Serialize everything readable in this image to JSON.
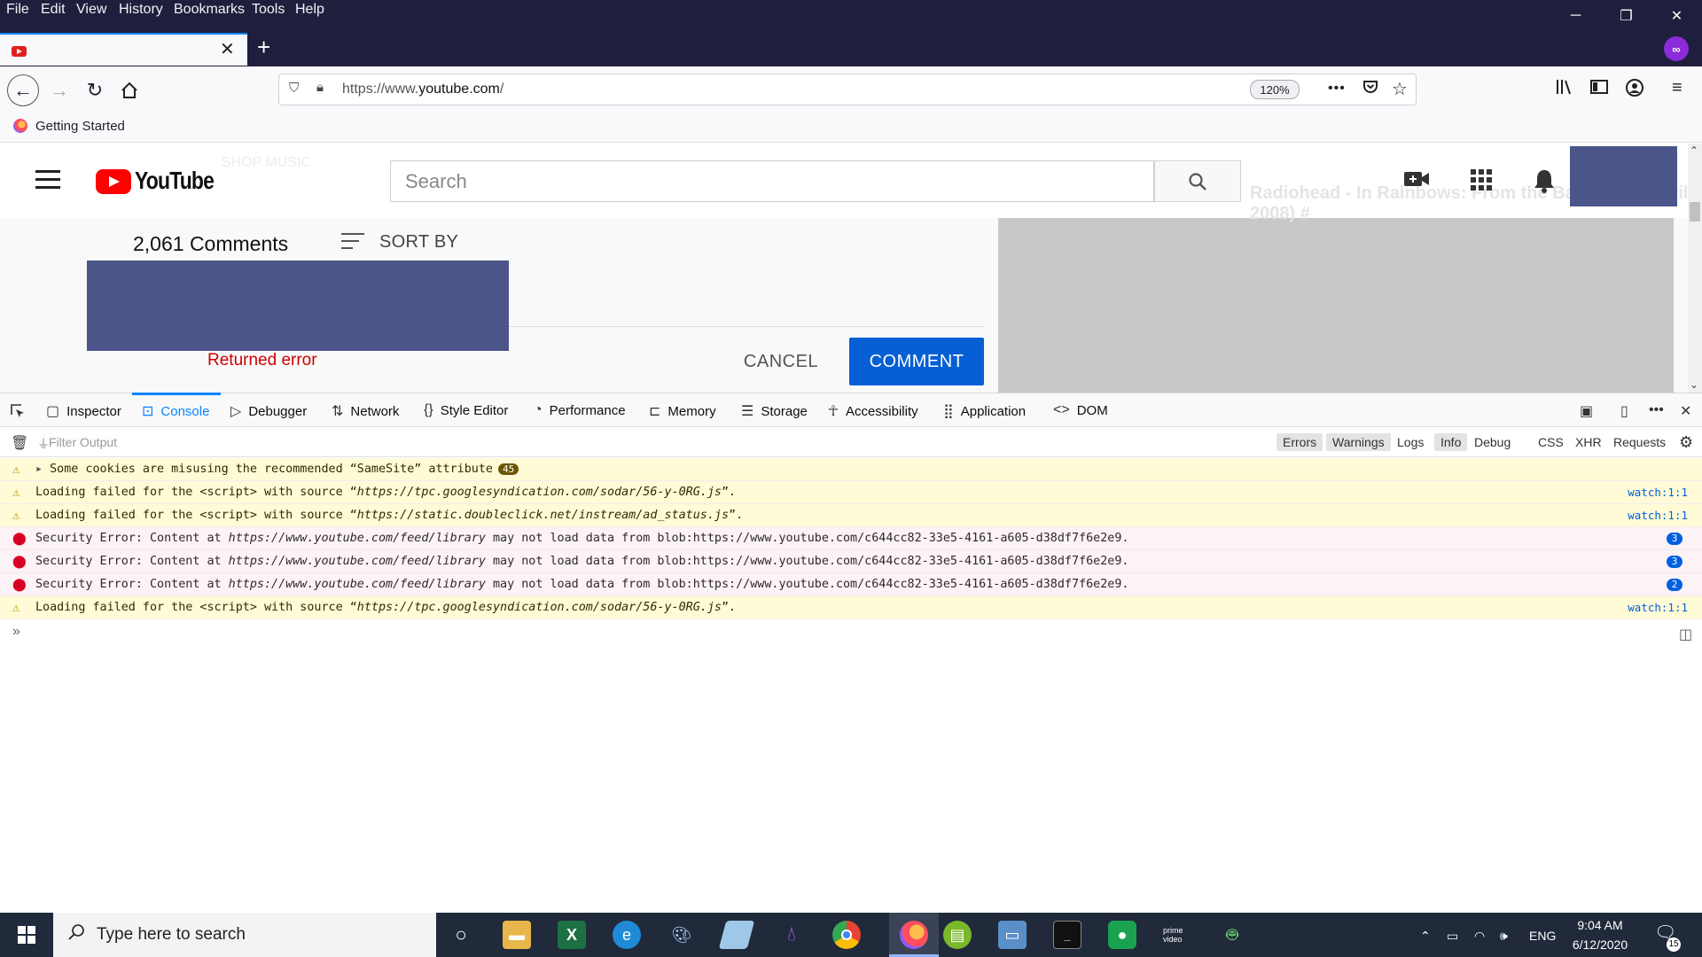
{
  "menubar": {
    "items": [
      "File",
      "Edit",
      "View",
      "History",
      "Bookmarks",
      "Tools",
      "Help"
    ],
    "window_controls": {
      "minimize": "─",
      "restore": "❐",
      "close": "✕"
    }
  },
  "tabs": {
    "active_tab_title": "",
    "new_tab": "+",
    "private_badge": "∞"
  },
  "navbar": {
    "url_prefix": "https://www.",
    "url_domain": "youtube.com",
    "url_suffix": "/",
    "zoom": "120%",
    "page_actions": "•••"
  },
  "bookmarks": {
    "items": [
      "Getting Started"
    ]
  },
  "youtube": {
    "logo_text": "YouTube",
    "search_placeholder": "Search",
    "comments_count": "2,061 Comments",
    "sort_by": "SORT BY",
    "returned_error": "Returned error",
    "cancel_label": "CANCEL",
    "comment_label": "COMMENT",
    "faded_sidebar_title": "Radiohead - In Rainbows: From the Basement (April 2008) #",
    "faded_header_text": "SHOP MUSIC"
  },
  "devtools": {
    "tabs": [
      "Inspector",
      "Console",
      "Debugger",
      "Network",
      "Style Editor",
      "Performance",
      "Memory",
      "Storage",
      "Accessibility",
      "Application",
      "DOM"
    ],
    "filter_placeholder": "Filter Output",
    "filters": [
      "Errors",
      "Warnings",
      "Logs",
      "Info",
      "Debug",
      "CSS",
      "XHR",
      "Requests"
    ],
    "active_filters": [
      "Errors",
      "Warnings",
      "Info"
    ],
    "messages": [
      {
        "level": "warning",
        "pre": "Some cookies are misusing the recommended “SameSite” attribute",
        "badge": "45",
        "loc": ""
      },
      {
        "level": "warning",
        "pre": "Loading failed for the <script> with source “",
        "src": "https://tpc.googlesyndication.com/sodar/56-y-0RG.js",
        "post": "”.",
        "loc": "watch:1:1"
      },
      {
        "level": "warning",
        "pre": "Loading failed for the <script> with source “",
        "src": "https://static.doubleclick.net/instream/ad_status.js",
        "post": "”.",
        "loc": "watch:1:1"
      },
      {
        "level": "error",
        "pre": "Security Error: Content at ",
        "src": "https://www.youtube.com/feed/library",
        "post": " may not load data from blob:https://www.youtube.com/c644cc82-33e5-4161-a605-d38df7f6e2e9.",
        "count": "3"
      },
      {
        "level": "error",
        "pre": "Security Error: Content at ",
        "src": "https://www.youtube.com/feed/library",
        "post": " may not load data from blob:https://www.youtube.com/c644cc82-33e5-4161-a605-d38df7f6e2e9.",
        "count": "3"
      },
      {
        "level": "error",
        "pre": "Security Error: Content at ",
        "src": "https://www.youtube.com/feed/library",
        "post": " may not load data from blob:https://www.youtube.com/c644cc82-33e5-4161-a605-d38df7f6e2e9.",
        "count": "2"
      },
      {
        "level": "warning",
        "pre": "Loading failed for the <script> with source “",
        "src": "https://tpc.googlesyndication.com/sodar/56-y-0RG.js",
        "post": "”.",
        "loc": "watch:1:1"
      }
    ],
    "prompt": "»"
  },
  "taskbar": {
    "search_text": "Type here to search",
    "time": "9:04 AM",
    "date": "6/12/2020",
    "language": "ENG",
    "notification_count": "15",
    "prime_label": "prime video"
  },
  "colors": {
    "titlebar": "#1f1f3d",
    "youtube_red": "#ff0000",
    "comment_button": "#065fd4",
    "error_text": "#cc0000",
    "devtools_accent": "#0a84ff",
    "placeholder_block": "#4b5589"
  }
}
